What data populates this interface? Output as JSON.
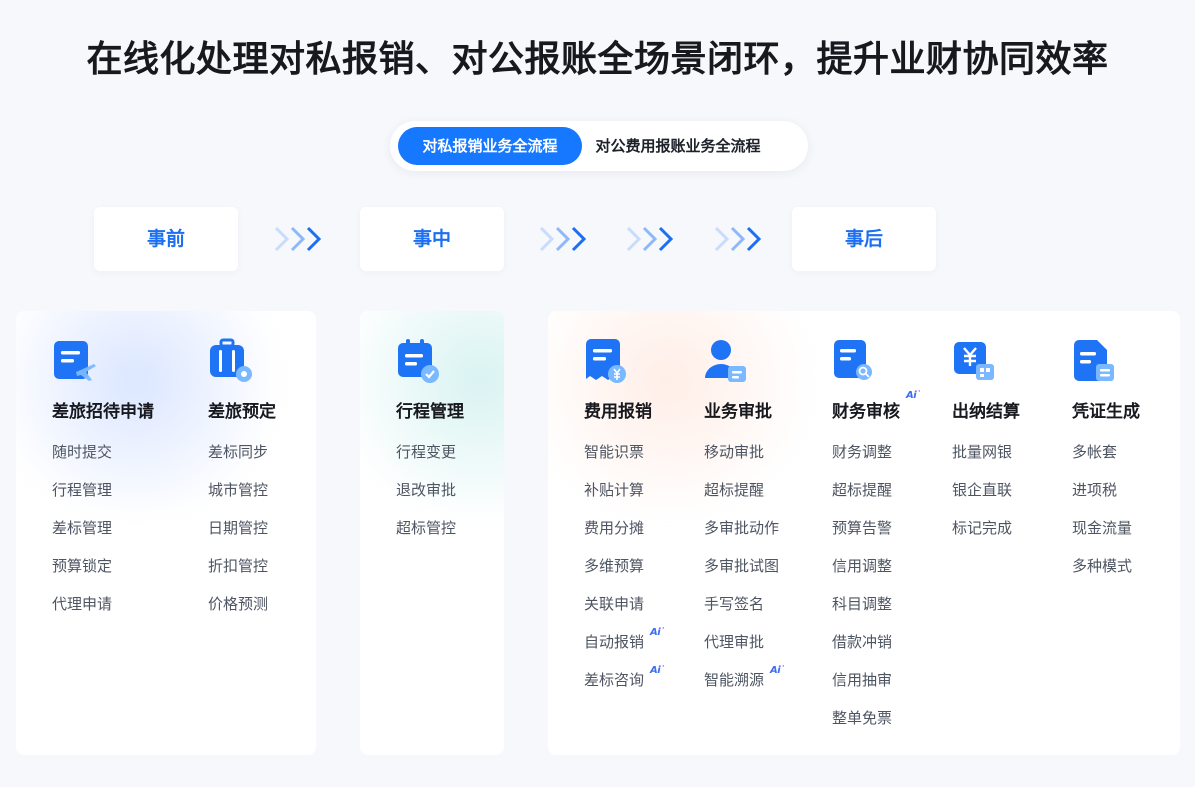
{
  "headline": "在线化处理对私报销、对公报账全场景闭环，提升业财协同效率",
  "tabs": [
    {
      "label": "对私报销业务全流程",
      "active": true
    },
    {
      "label": "对公费用报账业务全流程",
      "active": false
    }
  ],
  "phases": [
    "事前",
    "事中",
    "事后"
  ],
  "ai_badge": "Ai",
  "columns": [
    {
      "title": "差旅招待申请",
      "icon": "travel-apply-icon",
      "items": [
        "随时提交",
        "行程管理",
        "差标管理",
        "预算锁定",
        "代理申请"
      ]
    },
    {
      "title": "差旅预定",
      "icon": "luggage-booking-icon",
      "items": [
        "差标同步",
        "城市管控",
        "日期管控",
        "折扣管控",
        "价格预测"
      ]
    },
    {
      "title": "行程管理",
      "icon": "calendar-check-icon",
      "items": [
        "行程变更",
        "退改审批",
        "超标管控"
      ]
    },
    {
      "title": "费用报销",
      "icon": "expense-doc-icon",
      "items": [
        "智能识票",
        "补贴计算",
        "费用分摊",
        "多维预算",
        "关联申请",
        "自动报销",
        "差标咨询"
      ]
    },
    {
      "title": "业务审批",
      "icon": "user-approval-icon",
      "items": [
        "移动审批",
        "超标提醒",
        "多审批动作",
        "多审批试图",
        "手写签名",
        "代理审批",
        "智能溯源"
      ]
    },
    {
      "title": "财务审核",
      "icon": "finance-audit-icon",
      "items": [
        "财务调整",
        "超标提醒",
        "预算告警",
        "信用调整",
        "科目调整",
        "借款冲销",
        "信用抽审",
        "整单免票"
      ]
    },
    {
      "title": "出纳结算",
      "icon": "cashier-settle-icon",
      "items": [
        "批量网银",
        "银企直联",
        "标记完成"
      ]
    },
    {
      "title": "凭证生成",
      "icon": "voucher-doc-icon",
      "items": [
        "多帐套",
        "进项税",
        "现金流量",
        "多种模式"
      ]
    }
  ],
  "colors": {
    "primary": "#1677ff",
    "phase_text": "#1c6ef2",
    "background": "#f6f8fb"
  }
}
